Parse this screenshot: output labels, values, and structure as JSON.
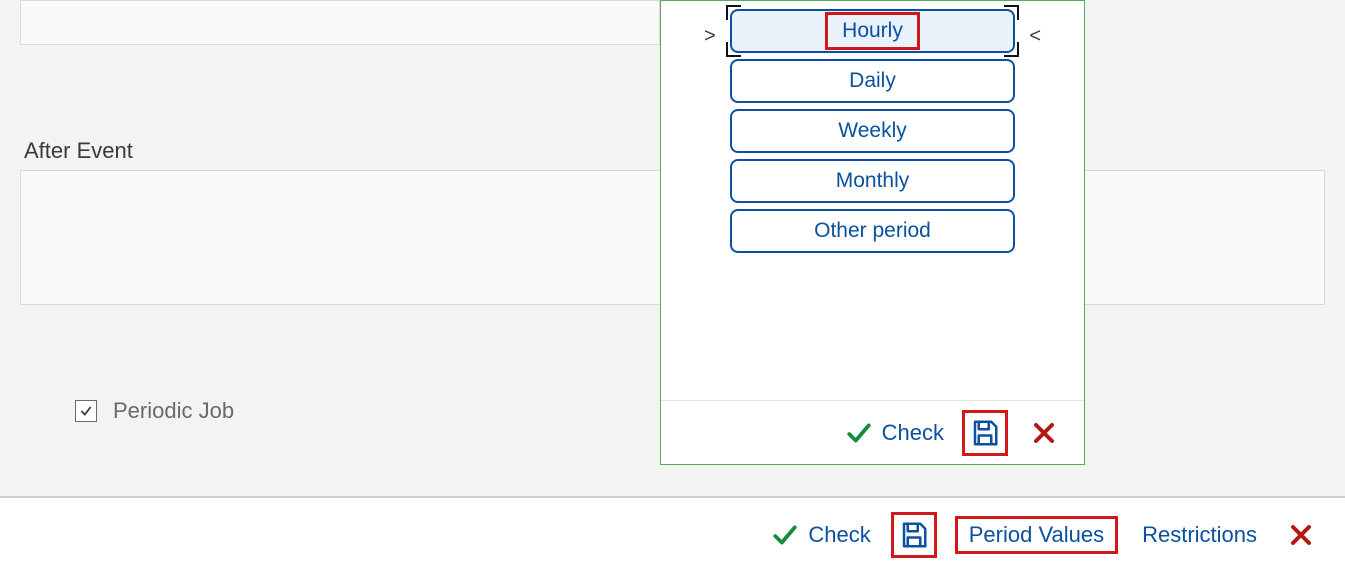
{
  "labels": {
    "after_event": "After Event",
    "periodic_job": "Periodic Job"
  },
  "popup": {
    "options": {
      "hourly": "Hourly",
      "daily": "Daily",
      "weekly": "Weekly",
      "monthly": "Monthly",
      "other": "Other period"
    },
    "footer": {
      "check": "Check"
    },
    "pointer_left": ">",
    "pointer_right": "<"
  },
  "bottombar": {
    "check": "Check",
    "period_values": "Period Values",
    "restrictions": "Restrictions"
  },
  "periodic_job_checked": true
}
